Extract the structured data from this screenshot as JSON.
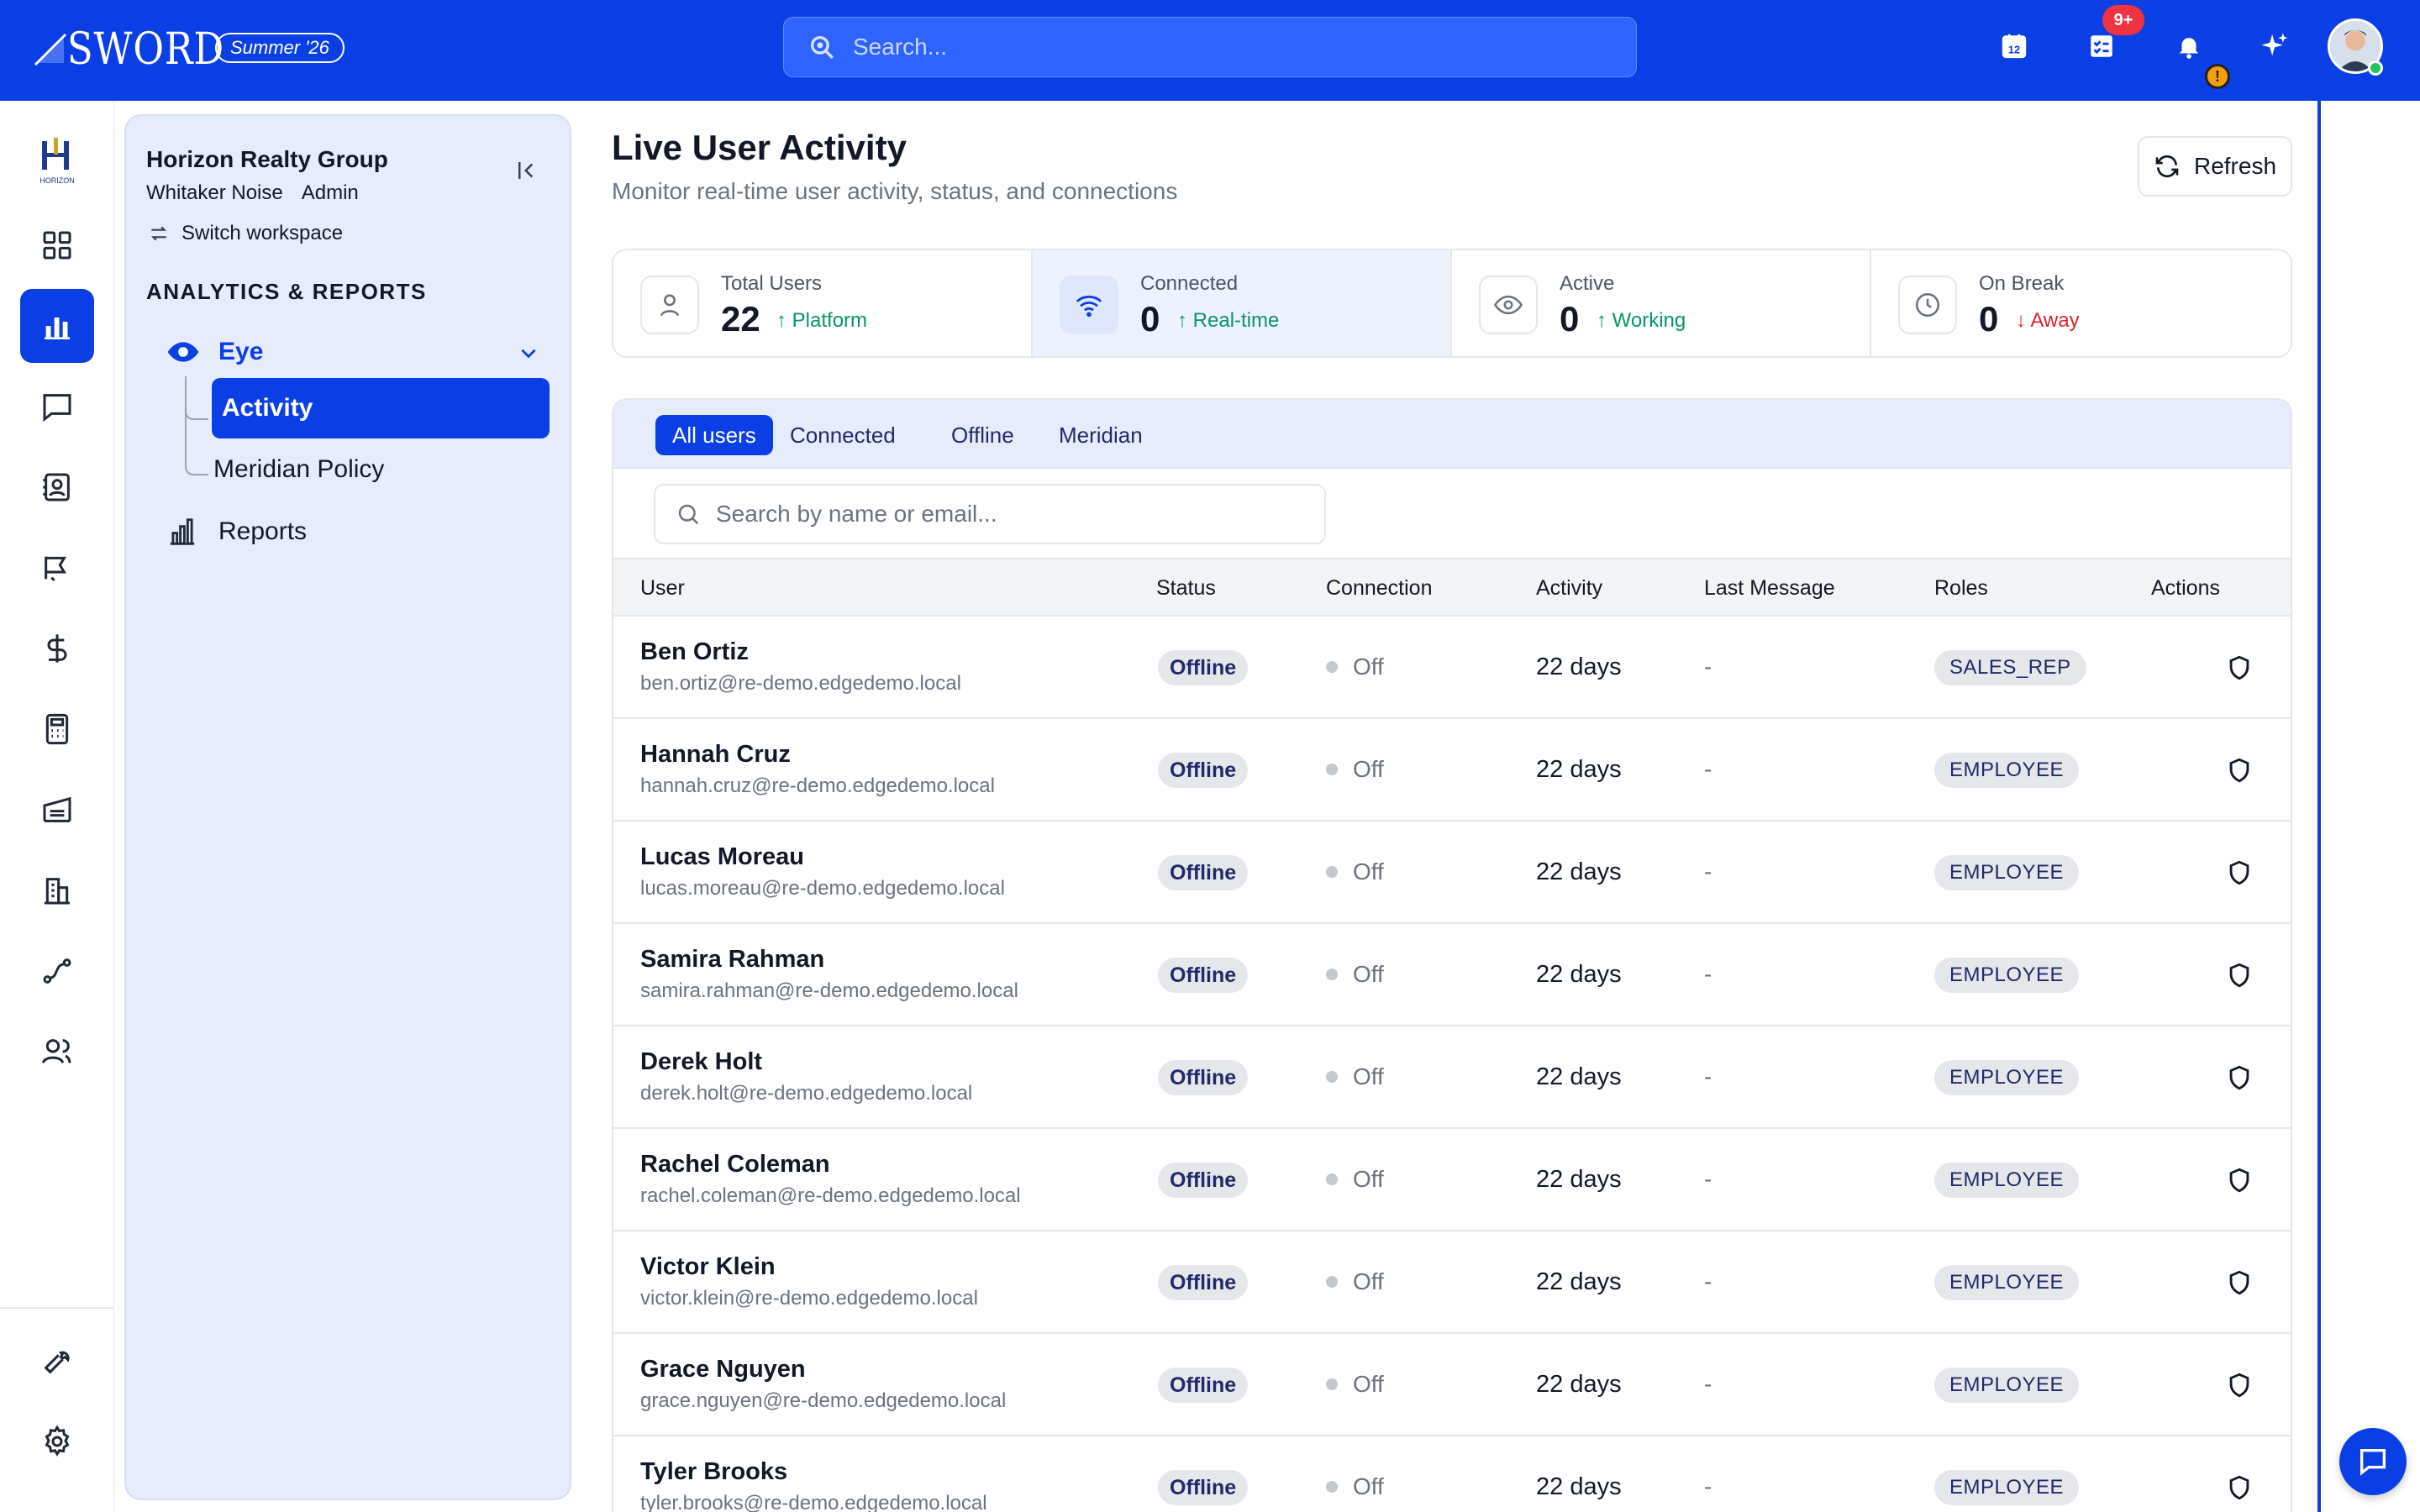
{
  "header": {
    "brand": "SWORD",
    "season": "Summer '26",
    "search_placeholder": "Search...",
    "notification_count": "9+",
    "alert_badge": "!"
  },
  "sidebar": {
    "org_name": "Horizon Realty Group",
    "user_name": "Whitaker Noise",
    "user_role": "Admin",
    "switch_workspace": "Switch workspace",
    "section_title": "ANALYTICS & REPORTS",
    "eye_label": "Eye",
    "activity_label": "Activity",
    "meridian_label": "Meridian Policy",
    "reports_label": "Reports"
  },
  "page": {
    "title": "Live User Activity",
    "subtitle": "Monitor real-time user activity, status, and connections",
    "refresh_label": "Refresh"
  },
  "stats": [
    {
      "label": "Total Users",
      "value": "22",
      "trend": "↑ Platform",
      "dir": "up"
    },
    {
      "label": "Connected",
      "value": "0",
      "trend": "↑ Real-time",
      "dir": "up"
    },
    {
      "label": "Active",
      "value": "0",
      "trend": "↑ Working",
      "dir": "up"
    },
    {
      "label": "On Break",
      "value": "0",
      "trend": "↓ Away",
      "dir": "down"
    }
  ],
  "tabs": [
    "All users",
    "Connected",
    "Offline",
    "Meridian"
  ],
  "table": {
    "search_placeholder": "Search by name or email...",
    "columns": [
      "User",
      "Status",
      "Connection",
      "Activity",
      "Last Message",
      "Roles",
      "Actions"
    ],
    "rows": [
      {
        "name": "Ben Ortiz",
        "email": "ben.ortiz@re-demo.edgedemo.local",
        "status": "Offline",
        "connection": "Off",
        "activity": "22 days",
        "last_message": "-",
        "role": "SALES_REP"
      },
      {
        "name": "Hannah Cruz",
        "email": "hannah.cruz@re-demo.edgedemo.local",
        "status": "Offline",
        "connection": "Off",
        "activity": "22 days",
        "last_message": "-",
        "role": "EMPLOYEE"
      },
      {
        "name": "Lucas Moreau",
        "email": "lucas.moreau@re-demo.edgedemo.local",
        "status": "Offline",
        "connection": "Off",
        "activity": "22 days",
        "last_message": "-",
        "role": "EMPLOYEE"
      },
      {
        "name": "Samira Rahman",
        "email": "samira.rahman@re-demo.edgedemo.local",
        "status": "Offline",
        "connection": "Off",
        "activity": "22 days",
        "last_message": "-",
        "role": "EMPLOYEE"
      },
      {
        "name": "Derek Holt",
        "email": "derek.holt@re-demo.edgedemo.local",
        "status": "Offline",
        "connection": "Off",
        "activity": "22 days",
        "last_message": "-",
        "role": "EMPLOYEE"
      },
      {
        "name": "Rachel Coleman",
        "email": "rachel.coleman@re-demo.edgedemo.local",
        "status": "Offline",
        "connection": "Off",
        "activity": "22 days",
        "last_message": "-",
        "role": "EMPLOYEE"
      },
      {
        "name": "Victor Klein",
        "email": "victor.klein@re-demo.edgedemo.local",
        "status": "Offline",
        "connection": "Off",
        "activity": "22 days",
        "last_message": "-",
        "role": "EMPLOYEE"
      },
      {
        "name": "Grace Nguyen",
        "email": "grace.nguyen@re-demo.edgedemo.local",
        "status": "Offline",
        "connection": "Off",
        "activity": "22 days",
        "last_message": "-",
        "role": "EMPLOYEE"
      },
      {
        "name": "Tyler Brooks",
        "email": "tyler.brooks@re-demo.edgedemo.local",
        "status": "Offline",
        "connection": "Off",
        "activity": "22 days",
        "last_message": "-",
        "role": "EMPLOYEE"
      }
    ]
  },
  "icons": {
    "rail": [
      "dashboard-icon",
      "analytics-icon",
      "chat-icon",
      "contacts-icon",
      "marketing-icon",
      "dollar-icon",
      "calculator-icon",
      "warehouse-icon",
      "buildings-icon",
      "workflow-icon",
      "team-icon",
      "tools-icon",
      "settings-icon"
    ]
  },
  "colors": {
    "brand_blue": "#0b3fe6",
    "panel_bg": "#e7ecfd",
    "trend_up": "#059669",
    "trend_down": "#dc2626"
  }
}
